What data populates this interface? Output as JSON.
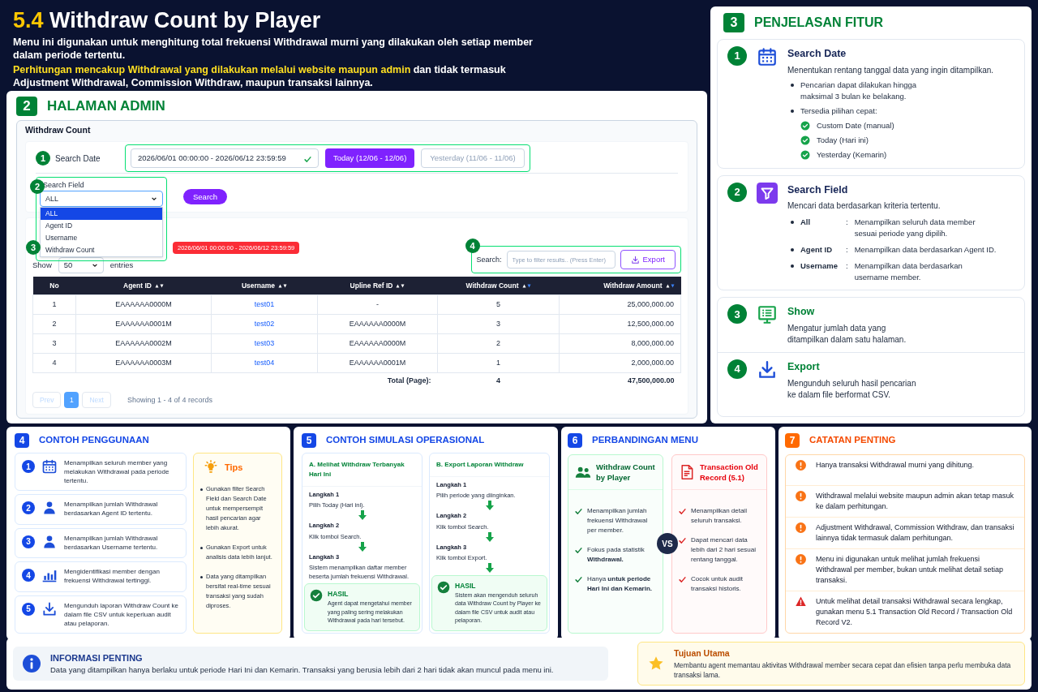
{
  "header": {
    "number": "5.4",
    "title": "Withdraw Count by Player",
    "description": "Menu ini digunakan untuk menghitung total frekuensi Withdrawal murni yang dilakukan oleh setiap member dalam periode tertentu.",
    "note_highlight": "Perhitungan mencakup Withdrawal yang dilakukan melalui website maupun admin",
    "note_rest": " dan tidak termasuk Adjustment Withdrawal, Commission Withdraw, maupun transaksi lainnya."
  },
  "admin": {
    "number": "2",
    "title": "HALAMAN ADMIN",
    "page_title": "Withdraw Count",
    "search_date": {
      "marker": "1",
      "label": "Search Date",
      "value": "2026/06/01 00:00:00 - 2026/06/12 23:59:59",
      "quick": [
        {
          "label": "Today (12/06 - 12/06)",
          "selected": true
        },
        {
          "label": "Yesterday (11/06 - 11/06)",
          "selected": false
        }
      ]
    },
    "search_field": {
      "marker": "2",
      "label": "Search Field",
      "value": "ALL",
      "expanded": true,
      "options": [
        {
          "label": "ALL",
          "selected": true
        },
        {
          "label": "Agent ID",
          "selected": false
        },
        {
          "label": "Username",
          "selected": false
        },
        {
          "label": "Withdraw Count",
          "selected": false
        }
      ]
    },
    "search_button": "Search",
    "show_marker": "3",
    "date_badge": "2026/06/01 00:00:00 - 2026/06/12 23:59:59",
    "show": {
      "label": "Show",
      "value": "50",
      "suffix": "entries"
    },
    "filter": {
      "marker": "4",
      "label": "Search:",
      "placeholder": "Type to filter results.. (Press Enter)"
    },
    "export_button": "Export",
    "table": {
      "columns": [
        "No",
        "Agent ID",
        "Username",
        "Upline Ref ID",
        "Withdraw Count",
        "Withdraw Amount"
      ],
      "rows": [
        [
          "1",
          "EAAAAAA0000M",
          "test01",
          "-",
          "5",
          "25,000,000.00"
        ],
        [
          "2",
          "EAAAAAA0001M",
          "test02",
          "EAAAAAA0000M",
          "3",
          "12,500,000.00"
        ],
        [
          "3",
          "EAAAAAA0002M",
          "test03",
          "EAAAAAA0000M",
          "2",
          "8,000,000.00"
        ],
        [
          "4",
          "EAAAAAA0003M",
          "test04",
          "EAAAAAA0001M",
          "1",
          "2,000,000.00"
        ]
      ],
      "total": {
        "label": "Total (Page):",
        "count": "4",
        "amount": "47,500,000.00"
      }
    },
    "pagination": {
      "prev": {
        "label": "Prev",
        "disabled": true
      },
      "pages": [
        {
          "label": "1",
          "selected": true
        }
      ],
      "next": {
        "label": "Next",
        "disabled": true
      },
      "info": "Showing 1 - 4 of 4 records"
    }
  },
  "features": {
    "number": "3",
    "title": "PENJELASAN FITUR",
    "items": [
      {
        "kind": "bullets",
        "marker": "1",
        "title": "Search Date",
        "description": "Menentukan rentang tanggal data yang ingin ditampilkan.",
        "bullets": [
          {
            "text": "Pencarian dapat dilakukan hingga maksimal 3 bulan ke belakang."
          },
          {
            "text": "Tersedia pilihan cepat:",
            "checks": [
              "Custom Date (manual)",
              "Today (Hari ini)",
              "Yesterday (Kemarin)"
            ]
          }
        ]
      },
      {
        "kind": "definitions",
        "marker": "2",
        "title": "Search Field",
        "description": "Mencari data berdasarkan kriteria tertentu.",
        "definitions": [
          {
            "term": "All",
            "separator": ":",
            "definition": "Menampilkan seluruh data member sesuai periode yang dipilih."
          },
          {
            "term": "Agent ID",
            "separator": ":",
            "definition": "Menampilkan data berdasarkan Agent ID."
          },
          {
            "term": "Username",
            "separator": ":",
            "definition": "Menampilkan data berdasarkan username member."
          }
        ]
      },
      {
        "kind": "plain",
        "marker": "3",
        "title": "Show",
        "description": "Mengatur jumlah data yang ditampilkan dalam satu halaman."
      },
      {
        "kind": "plain",
        "marker": "4",
        "title": "Export",
        "description": "Mengunduh seluruh hasil pencarian ke dalam file berformat CSV."
      }
    ]
  },
  "usage": {
    "number": "4",
    "title": "CONTOH PENGGUNAAN",
    "items": [
      {
        "marker": "1",
        "text": "Menampilkan seluruh member yang melakukan Withdrawal pada periode tertentu."
      },
      {
        "marker": "2",
        "text": "Menampilkan jumlah Withdrawal berdasarkan Agent ID tertentu."
      },
      {
        "marker": "3",
        "text": "Menampilkan jumlah Withdrawal berdasarkan Username tertentu."
      },
      {
        "marker": "4",
        "text": "Mengidentifikasi member dengan frekuensi Withdrawal tertinggi."
      },
      {
        "marker": "5",
        "text": "Mengunduh laporan Withdraw Count ke dalam file CSV untuk keperluan audit atau pelaporan."
      }
    ],
    "tips": {
      "title": "Tips",
      "items": [
        "Gunakan filter Search Field dan Search Date untuk mempersempit hasil pencarian agar lebih akurat.",
        "Gunakan Export untuk analisis data lebih lanjut.",
        "Data yang ditampilkan bersifat real-time sesuai transaksi yang sudah diproses."
      ]
    }
  },
  "simulation": {
    "number": "5",
    "title": "CONTOH SIMULASI OPERASIONAL",
    "scenarios": [
      {
        "title": "A. Melihat Withdraw Terbanyak Hari Ini",
        "trailing_arrow": false,
        "steps": [
          {
            "label": "Langkah 1",
            "text": "Pilih Today (Hari ini)."
          },
          {
            "label": "Langkah 2",
            "text": "Klik tombol Search."
          },
          {
            "label": "Langkah 3",
            "text": "Sistem menampilkan daftar member beserta jumlah frekuensi Withdrawal."
          }
        ],
        "result": {
          "title": "HASIL",
          "text": "Agent dapat mengetahui member yang paling sering melakukan Withdrawal pada hari tersebut."
        }
      },
      {
        "title": "B. Export Laporan Withdraw",
        "trailing_arrow": true,
        "steps": [
          {
            "label": "Langkah 1",
            "text": "Pilih periode yang diinginkan."
          },
          {
            "label": "Langkah 2",
            "text": "Klik tombol Search."
          },
          {
            "label": "Langkah 3",
            "text": "Klik tombol Export."
          }
        ],
        "result": {
          "title": "HASIL",
          "text": "Sistem akan mengenduh seluruh data Withdraw Count by Player ke dalam file CSV untuk audit atau pelaporan."
        }
      }
    ]
  },
  "comparison": {
    "number": "6",
    "title": "PERBANDINGAN MENU",
    "vs": "VS",
    "cards": [
      {
        "title": "Withdraw Count by Player",
        "points": [
          "Menampilkan jumlah frekuensi Withdrawal per member.",
          "Fokus pada statistik **Withdrawal.**",
          "Hanya **untuk periode Hari Ini dan Kemarin.**"
        ]
      },
      {
        "title": "Transaction Old Record (5.1)",
        "points": [
          "Menampilkan detail seluruh transaksi.",
          "Dapat mencari data lebih dari 2 hari sesuai rentang tanggal.",
          "Cocok untuk audit transaksi historis."
        ]
      }
    ]
  },
  "notes": {
    "number": "7",
    "title": "CATATAN PENTING",
    "items": [
      {
        "kind": "info",
        "text": "Hanya transaksi Withdrawal murni yang dihitung."
      },
      {
        "kind": "info",
        "text": "Withdrawal melalui website maupun admin akan tetap masuk ke dalam perhitungan."
      },
      {
        "kind": "info",
        "text": "Adjustment Withdrawal, Commission Withdraw, dan transaksi lainnya tidak termasuk dalam perhitungan."
      },
      {
        "kind": "info",
        "text": "Menu ini digunakan untuk melihat jumlah frekuensi Withdrawal per member, bukan untuk melihat detail setiap transaksi."
      },
      {
        "kind": "warning",
        "text": "Untuk melihat detail transaksi Withdrawal secara lengkap, gunakan menu 5.1 Transaction Old Record / Transaction Old Record V2."
      }
    ]
  },
  "info": {
    "title": "INFORMASI PENTING",
    "text": "Data yang ditampilkan hanya berlaku untuk periode Hari Ini dan Kemarin. Transaksi yang berusia lebih dari 2 hari tidak akan muncul pada menu ini."
  },
  "goal": {
    "title": "Tujuan Utama",
    "text": "Membantu agent memantau aktivitas Withdrawal member secara cepat dan efisien tanpa perlu membuka data transaksi lama."
  }
}
